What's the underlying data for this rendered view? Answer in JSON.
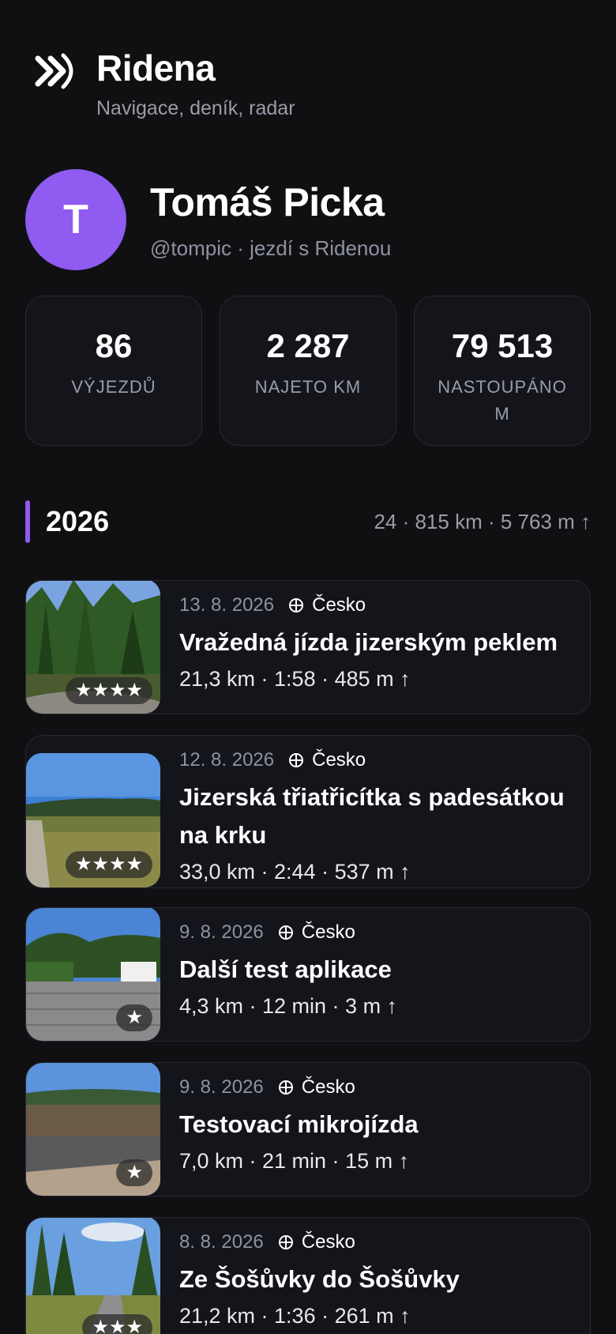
{
  "app": {
    "name": "Ridena",
    "subtitle": "Navigace, deník, radar",
    "logo_icon": "ride-logo-icon"
  },
  "profile": {
    "avatar_initial": "T",
    "name": "Tomáš Picka",
    "handle_line": "@tompic · jezdí s Ridenou",
    "avatar_color": "#8f5bf0"
  },
  "stats": [
    {
      "value": "86",
      "label": "VÝJEZDŮ"
    },
    {
      "value": "2 287",
      "label": "NAJETO KM"
    },
    {
      "value": "79 513",
      "label": "NASTOUPÁNO M"
    }
  ],
  "year_section": {
    "year": "2026",
    "summary": "24 · 815 km · 5 763 m ↑",
    "accent": "#8f5bf0"
  },
  "rides": [
    {
      "date": "13. 8. 2026",
      "country": "Česko",
      "title": "Vražedná jízda jizerským peklem",
      "stats": "21,3 km · 1:58 · 485 m ↑",
      "rating": 4,
      "rating_text": "★★★★"
    },
    {
      "date": "12. 8. 2026",
      "country": "Česko",
      "title": "Jizerská třiatřicítka s padesátkou na krku",
      "stats": "33,0 km · 2:44 · 537 m ↑",
      "rating": 4,
      "rating_text": "★★★★"
    },
    {
      "date": "9. 8. 2026",
      "country": "Česko",
      "title": "Další test aplikace",
      "stats": "4,3 km · 12 min · 3 m ↑",
      "rating": 1,
      "rating_text": "★"
    },
    {
      "date": "9. 8. 2026",
      "country": "Česko",
      "title": "Testovací mikrojízda",
      "stats": "7,0 km · 21 min · 15 m ↑",
      "rating": 1,
      "rating_text": "★"
    },
    {
      "date": "8. 8. 2026",
      "country": "Česko",
      "title": "Ze Šošůvky do Šošůvky",
      "stats": "21,2 km · 1:36 · 261 m ↑",
      "rating": 3,
      "rating_text": "★★★"
    }
  ]
}
